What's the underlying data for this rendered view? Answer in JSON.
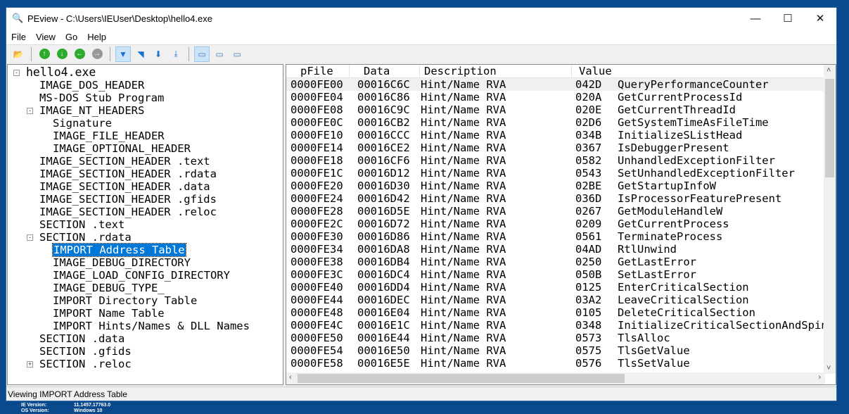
{
  "window": {
    "title": "PEview - C:\\Users\\IEUser\\Desktop\\hello4.exe",
    "minimize": "—",
    "maximize": "☐",
    "close": "✕"
  },
  "menu": [
    "File",
    "View",
    "Go",
    "Help"
  ],
  "toolbar": [
    "open-icon",
    "up-icon",
    "down-icon",
    "back-icon",
    "forward-icon",
    "view-byte-icon",
    "view-word-icon",
    "view-dword-icon",
    "view-qword-icon",
    "list-view-icon",
    "detail-view-icon",
    "wide-view-icon"
  ],
  "tree": [
    {
      "label": "hello4.exe",
      "level": 0,
      "exp": "-"
    },
    {
      "label": "IMAGE_DOS_HEADER",
      "level": 1
    },
    {
      "label": "MS-DOS Stub Program",
      "level": 1
    },
    {
      "label": "IMAGE_NT_HEADERS",
      "level": 1,
      "exp": "-"
    },
    {
      "label": "Signature",
      "level": 2
    },
    {
      "label": "IMAGE_FILE_HEADER",
      "level": 2
    },
    {
      "label": "IMAGE_OPTIONAL_HEADER",
      "level": 2
    },
    {
      "label": "IMAGE_SECTION_HEADER .text",
      "level": 1
    },
    {
      "label": "IMAGE_SECTION_HEADER .rdata",
      "level": 1
    },
    {
      "label": "IMAGE_SECTION_HEADER .data",
      "level": 1
    },
    {
      "label": "IMAGE_SECTION_HEADER .gfids",
      "level": 1
    },
    {
      "label": "IMAGE_SECTION_HEADER .reloc",
      "level": 1
    },
    {
      "label": "SECTION .text",
      "level": 1
    },
    {
      "label": "SECTION .rdata",
      "level": 1,
      "exp": "-"
    },
    {
      "label": "IMPORT Address Table",
      "level": 2,
      "selected": true
    },
    {
      "label": "IMAGE_DEBUG_DIRECTORY",
      "level": 2
    },
    {
      "label": "IMAGE_LOAD_CONFIG_DIRECTORY",
      "level": 2
    },
    {
      "label": "IMAGE_DEBUG_TYPE_",
      "level": 2
    },
    {
      "label": "IMPORT Directory Table",
      "level": 2
    },
    {
      "label": "IMPORT Name Table",
      "level": 2
    },
    {
      "label": "IMPORT Hints/Names & DLL Names",
      "level": 2
    },
    {
      "label": "SECTION .data",
      "level": 1
    },
    {
      "label": "SECTION .gfids",
      "level": 1
    },
    {
      "label": "SECTION .reloc",
      "level": 1,
      "exp": "+"
    }
  ],
  "table": {
    "columns": [
      "pFile",
      "Data",
      "Description",
      "Value"
    ],
    "rows": [
      [
        "0000FE00",
        "00016C6C",
        "Hint/Name RVA",
        "042D",
        "QueryPerformanceCounter"
      ],
      [
        "0000FE04",
        "00016C86",
        "Hint/Name RVA",
        "020A",
        "GetCurrentProcessId"
      ],
      [
        "0000FE08",
        "00016C9C",
        "Hint/Name RVA",
        "020E",
        "GetCurrentThreadId"
      ],
      [
        "0000FE0C",
        "00016CB2",
        "Hint/Name RVA",
        "02D6",
        "GetSystemTimeAsFileTime"
      ],
      [
        "0000FE10",
        "00016CCC",
        "Hint/Name RVA",
        "034B",
        "InitializeSListHead"
      ],
      [
        "0000FE14",
        "00016CE2",
        "Hint/Name RVA",
        "0367",
        "IsDebuggerPresent"
      ],
      [
        "0000FE18",
        "00016CF6",
        "Hint/Name RVA",
        "0582",
        "UnhandledExceptionFilter"
      ],
      [
        "0000FE1C",
        "00016D12",
        "Hint/Name RVA",
        "0543",
        "SetUnhandledExceptionFilter"
      ],
      [
        "0000FE20",
        "00016D30",
        "Hint/Name RVA",
        "02BE",
        "GetStartupInfoW"
      ],
      [
        "0000FE24",
        "00016D42",
        "Hint/Name RVA",
        "036D",
        "IsProcessorFeaturePresent"
      ],
      [
        "0000FE28",
        "00016D5E",
        "Hint/Name RVA",
        "0267",
        "GetModuleHandleW"
      ],
      [
        "0000FE2C",
        "00016D72",
        "Hint/Name RVA",
        "0209",
        "GetCurrentProcess"
      ],
      [
        "0000FE30",
        "00016D86",
        "Hint/Name RVA",
        "0561",
        "TerminateProcess"
      ],
      [
        "0000FE34",
        "00016DA8",
        "Hint/Name RVA",
        "04AD",
        "RtlUnwind"
      ],
      [
        "0000FE38",
        "00016DB4",
        "Hint/Name RVA",
        "0250",
        "GetLastError"
      ],
      [
        "0000FE3C",
        "00016DC4",
        "Hint/Name RVA",
        "050B",
        "SetLastError"
      ],
      [
        "0000FE40",
        "00016DD4",
        "Hint/Name RVA",
        "0125",
        "EnterCriticalSection"
      ],
      [
        "0000FE44",
        "00016DEC",
        "Hint/Name RVA",
        "03A2",
        "LeaveCriticalSection"
      ],
      [
        "0000FE48",
        "00016E04",
        "Hint/Name RVA",
        "0105",
        "DeleteCriticalSection"
      ],
      [
        "0000FE4C",
        "00016E1C",
        "Hint/Name RVA",
        "0348",
        "InitializeCriticalSectionAndSpinCount"
      ],
      [
        "0000FE50",
        "00016E44",
        "Hint/Name RVA",
        "0573",
        "TlsAlloc"
      ],
      [
        "0000FE54",
        "00016E50",
        "Hint/Name RVA",
        "0575",
        "TlsGetValue"
      ],
      [
        "0000FE58",
        "00016E5E",
        "Hint/Name RVA",
        "0576",
        "TlsSetValue"
      ]
    ]
  },
  "status": "Viewing IMPORT Address Table",
  "desktop": {
    "ie_label": "IE Version:",
    "ie_value": "11.1457.17763.0",
    "os_label": "OS Version:",
    "os_value": "Windows 10"
  }
}
